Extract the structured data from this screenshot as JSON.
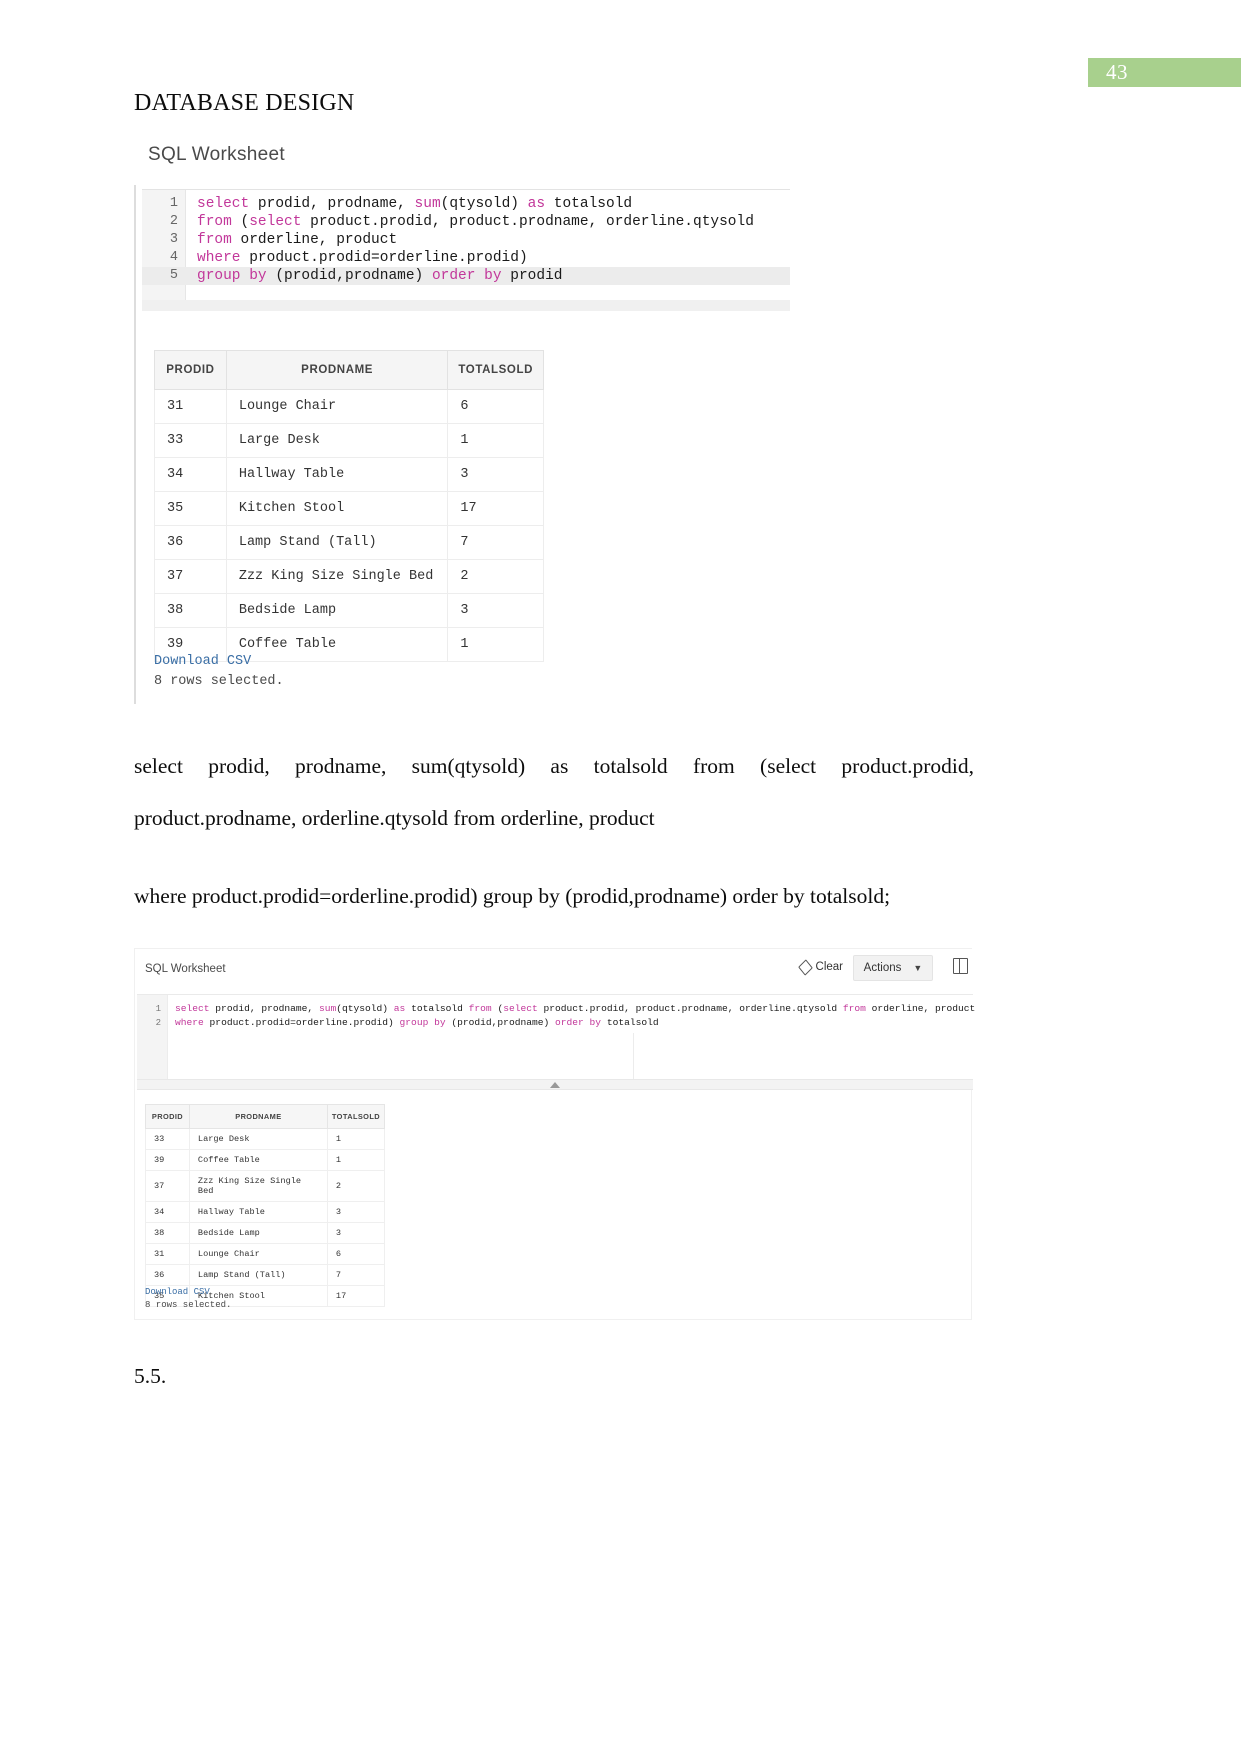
{
  "page": {
    "number": "43",
    "badge_color": "#a8d08d",
    "heading": "DATABASE DESIGN"
  },
  "figure1": {
    "worksheet_title": "SQL Worksheet",
    "code_lines": [
      {
        "num": "1",
        "segments": [
          {
            "t": "select",
            "kw": true
          },
          {
            "t": " prodid, prodname, ",
            "kw": false
          },
          {
            "t": "sum",
            "kw": true
          },
          {
            "t": "(qtysold) ",
            "kw": false
          },
          {
            "t": "as",
            "kw": true
          },
          {
            "t": " totalsold",
            "kw": false
          }
        ]
      },
      {
        "num": "2",
        "segments": [
          {
            "t": "from",
            "kw": true
          },
          {
            "t": " (",
            "kw": false
          },
          {
            "t": "select",
            "kw": true
          },
          {
            "t": " product.prodid, product.prodname, orderline.qtysold",
            "kw": false
          }
        ]
      },
      {
        "num": "3",
        "segments": [
          {
            "t": "from",
            "kw": true
          },
          {
            "t": " orderline, product",
            "kw": false
          }
        ]
      },
      {
        "num": "4",
        "segments": [
          {
            "t": "where",
            "kw": true
          },
          {
            "t": " product.prodid=orderline.prodid)",
            "kw": false
          }
        ]
      },
      {
        "num": "5",
        "active": true,
        "segments": [
          {
            "t": "group by",
            "kw": true
          },
          {
            "t": " (prodid,prodname) ",
            "kw": false
          },
          {
            "t": "order by",
            "kw": true
          },
          {
            "t": " prodid",
            "kw": false
          }
        ]
      }
    ],
    "table": {
      "headers": [
        "PRODID",
        "PRODNAME",
        "TOTALSOLD"
      ],
      "rows": [
        [
          "31",
          "Lounge Chair",
          "6"
        ],
        [
          "33",
          "Large Desk",
          "1"
        ],
        [
          "34",
          "Hallway Table",
          "3"
        ],
        [
          "35",
          "Kitchen Stool",
          "17"
        ],
        [
          "36",
          "Lamp Stand (Tall)",
          "7"
        ],
        [
          "37",
          "Zzz King Size Single Bed",
          "2"
        ],
        [
          "38",
          "Bedside Lamp",
          "3"
        ],
        [
          "39",
          "Coffee Table",
          "1"
        ]
      ]
    },
    "download_label": "Download CSV",
    "rows_note": "8 rows selected."
  },
  "paragraphs": {
    "p1": "select   prodid,   prodname,   sum(qtysold)   as   totalsold   from   (select   product.prodid, product.prodname, orderline.qtysold from orderline, product",
    "p2": "where product.prodid=orderline.prodid) group by (prodid,prodname) order by totalsold;",
    "p3": "5.5."
  },
  "figure2": {
    "worksheet_title": "SQL Worksheet",
    "toolbar": {
      "clear_label": "Clear",
      "clear_icon": "eraser-icon",
      "actions_label": "Actions",
      "actions_caret": "⌄",
      "panel_icon": "grid-panel-icon"
    },
    "code_lines": [
      {
        "num": "1",
        "segments": [
          {
            "t": "select",
            "kw": true
          },
          {
            "t": " prodid, prodname, ",
            "kw": false
          },
          {
            "t": "sum",
            "kw": true
          },
          {
            "t": "(qtysold) ",
            "kw": false
          },
          {
            "t": "as",
            "kw": true
          },
          {
            "t": " totalsold ",
            "kw": false
          },
          {
            "t": "from",
            "kw": true
          },
          {
            "t": " (",
            "kw": false
          },
          {
            "t": "select",
            "kw": true
          },
          {
            "t": " product.prodid, product.prodname, orderline.qtysold ",
            "kw": false
          },
          {
            "t": "from",
            "kw": true
          },
          {
            "t": " orderline, product",
            "kw": false
          }
        ]
      },
      {
        "num": "2",
        "segments": [
          {
            "t": "where",
            "kw": true
          },
          {
            "t": " product.prodid=orderline.prodid) ",
            "kw": false
          },
          {
            "t": "group by",
            "kw": true
          },
          {
            "t": " (prodid,prodname) ",
            "kw": false
          },
          {
            "t": "order by",
            "kw": true
          },
          {
            "t": " totalsold",
            "kw": false
          }
        ]
      }
    ],
    "table": {
      "headers": [
        "PRODID",
        "PRODNAME",
        "TOTALSOLD"
      ],
      "rows": [
        [
          "33",
          "Large Desk",
          "1"
        ],
        [
          "39",
          "Coffee Table",
          "1"
        ],
        [
          "37",
          "Zzz King Size Single Bed",
          "2"
        ],
        [
          "34",
          "Hallway Table",
          "3"
        ],
        [
          "38",
          "Bedside Lamp",
          "3"
        ],
        [
          "31",
          "Lounge Chair",
          "6"
        ],
        [
          "36",
          "Lamp Stand (Tall)",
          "7"
        ],
        [
          "35",
          "Kitchen Stool",
          "17"
        ]
      ]
    },
    "download_label": "Download CSV",
    "rows_note": "8 rows selected."
  }
}
